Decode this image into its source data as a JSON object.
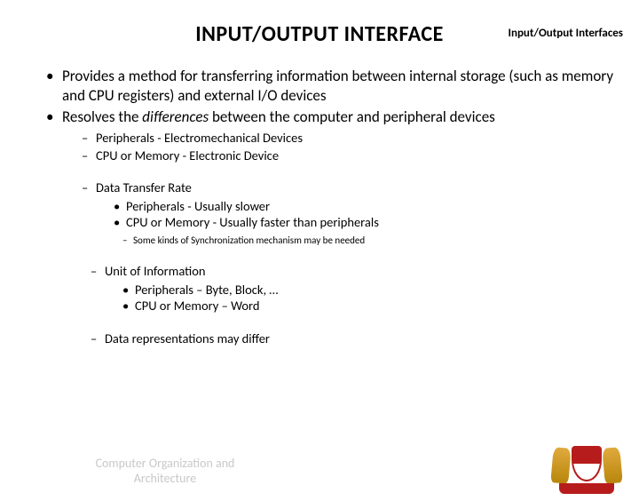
{
  "header_label": "Input/Output Interfaces",
  "title": "INPUT/OUTPUT  INTERFACE",
  "bullets": {
    "b1": "Provides a method for transferring information between internal storage (such as memory and CPU registers) and external I/O devices",
    "b2_pre": "Resolves the ",
    "b2_em": "differences",
    "b2_post": "  between the computer and peripheral devices",
    "s1": "Peripherals - Electromechanical Devices",
    "s2": "CPU or Memory - Electronic Device",
    "s3": "Data Transfer Rate",
    "s3a": "Peripherals - Usually slower",
    "s3b": "CPU or Memory - Usually faster than peripherals",
    "s3note": "Some kinds of Synchronization mechanism may be needed",
    "s4": "Unit of Information",
    "s4a": "Peripherals – Byte, Block, …",
    "s4b": "CPU or Memory – Word",
    "s5": "Data representations may differ"
  },
  "footer": {
    "l1": "Computer Organization and",
    "l2": "Architecture"
  }
}
